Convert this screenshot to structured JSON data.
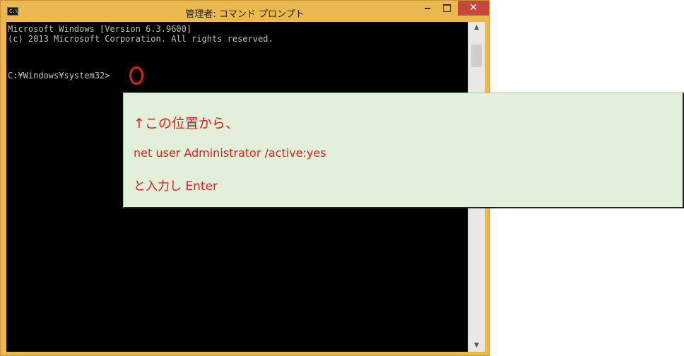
{
  "window": {
    "title": "管理者: コマンド プロンプト",
    "icon_label": "C:\\",
    "close_symbol": "✕"
  },
  "console": {
    "lines": [
      "Microsoft Windows [Version 6.3.9600]",
      "(c) 2013 Microsoft Corporation. All rights reserved.",
      "",
      "C:¥Windows¥system32>"
    ]
  },
  "scrollbar": {
    "up": "▲",
    "down": "▼"
  },
  "callout": {
    "line1": "↑この位置から、",
    "line2": "net user Administrator /active:yes",
    "line3": "と入力し Enter"
  },
  "colors": {
    "title_bar": "#e9b84f",
    "console_bg": "#000000",
    "console_text": "#c0c0c0",
    "annotation_red": "#e0201a",
    "callout_bg": "#e2efda",
    "close_button": "#c7463d"
  }
}
